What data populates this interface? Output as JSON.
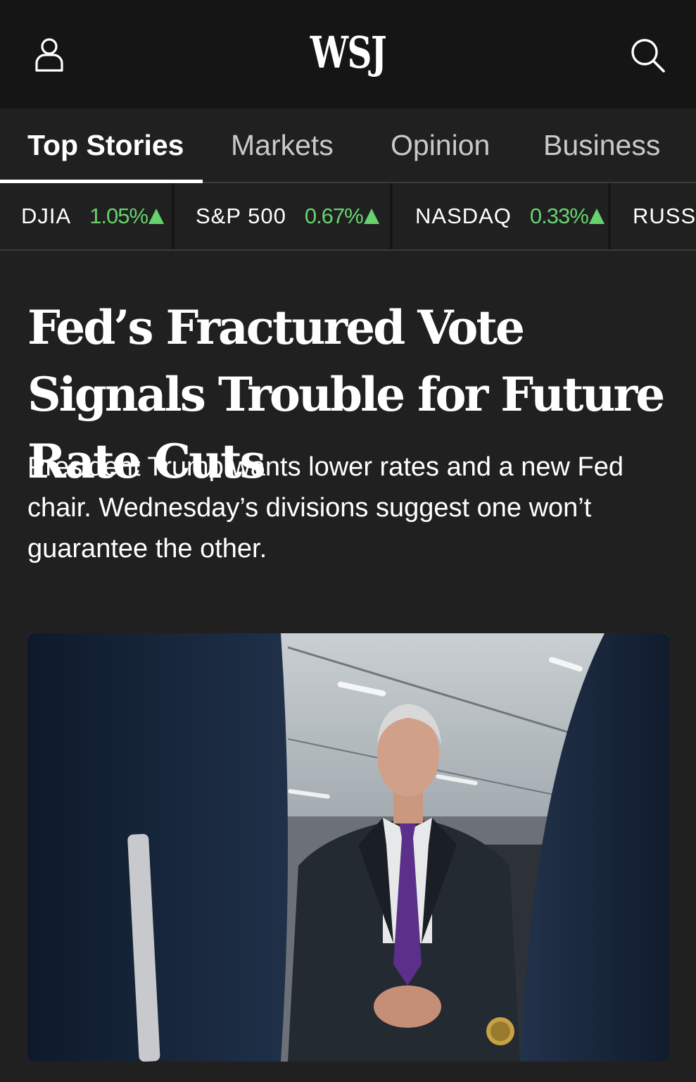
{
  "header": {
    "logo_text": "WSJ",
    "user_icon": "user-icon",
    "search_icon": "search-icon"
  },
  "tabs": [
    {
      "label": "Top Stories",
      "active": true
    },
    {
      "label": "Markets",
      "active": false
    },
    {
      "label": "Opinion",
      "active": false
    },
    {
      "label": "Business",
      "active": false
    }
  ],
  "ticker": [
    {
      "name": "DJIA",
      "change": "1.05%",
      "direction": "up"
    },
    {
      "name": "S&P 500",
      "change": "0.67%",
      "direction": "up"
    },
    {
      "name": "NASDAQ",
      "change": "0.33%",
      "direction": "up"
    },
    {
      "name": "RUSSE",
      "change": "",
      "direction": ""
    }
  ],
  "article": {
    "headline": "Fed’s Fractured Vote Signals Trouble for Future Rate Cuts",
    "dek": "President Trump wants lower rates and a new Fed chair. Wednesday’s divisions suggest one won’t guarantee the other."
  },
  "colors": {
    "background": "#202020",
    "header_background": "#151515",
    "positive": "#66d36e",
    "divider": "#3b3b3b"
  }
}
